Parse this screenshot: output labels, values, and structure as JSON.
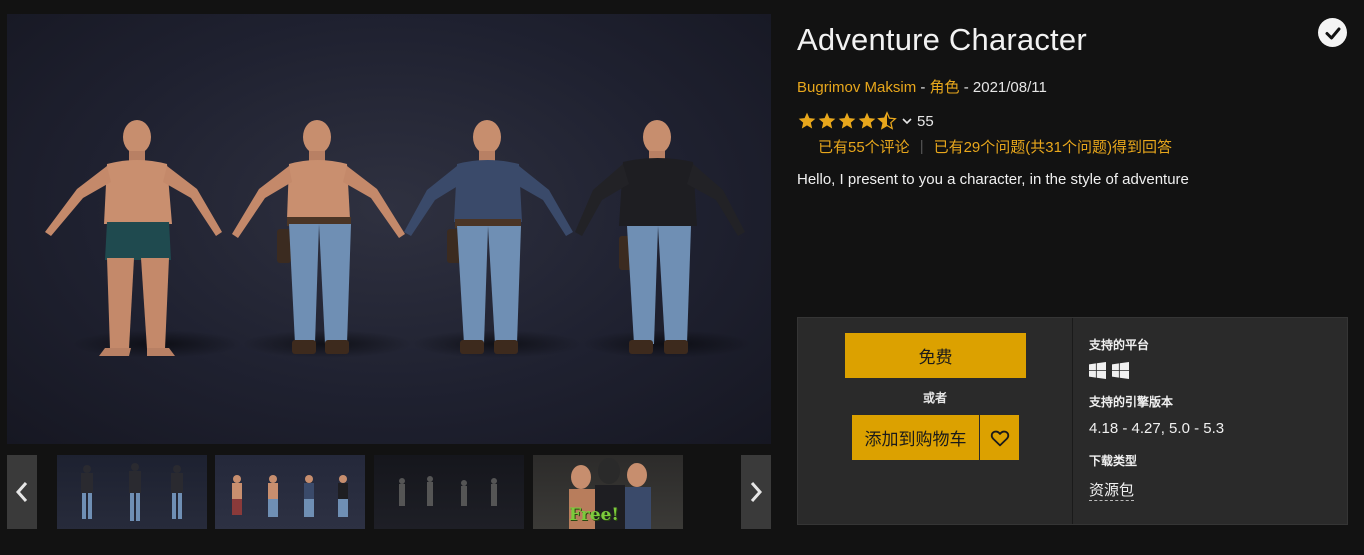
{
  "gallery": {
    "main_image_alt": "",
    "thumb4_overlay": "Free!"
  },
  "product": {
    "title": "Adventure Character",
    "author": "Bugrimov Maksim",
    "separator": " - ",
    "category": "角色",
    "date": "2021/08/11",
    "rating_stars": 4.5,
    "rating_count": "55",
    "reviews_link": "已有55个评论",
    "questions_link": "已有29个问题(共31个问题)得到回答",
    "description": "Hello, I present to you a character, in the style of adventure"
  },
  "purchase": {
    "free_label": "免费",
    "or_label": "或者",
    "add_to_cart_label": "添加到购物车"
  },
  "specs": {
    "platforms_label": "支持的平台",
    "platforms": [
      "windows-icon",
      "windows-icon"
    ],
    "engine_label": "支持的引擎版本",
    "engine_versions": "4.18 - 4.27, 5.0 - 5.3",
    "download_label": "下载类型",
    "download_type": "资源包"
  },
  "colors": {
    "accent": "#dca100",
    "link": "#e8a71c",
    "background": "#121212",
    "panel": "#2a2a2a"
  }
}
